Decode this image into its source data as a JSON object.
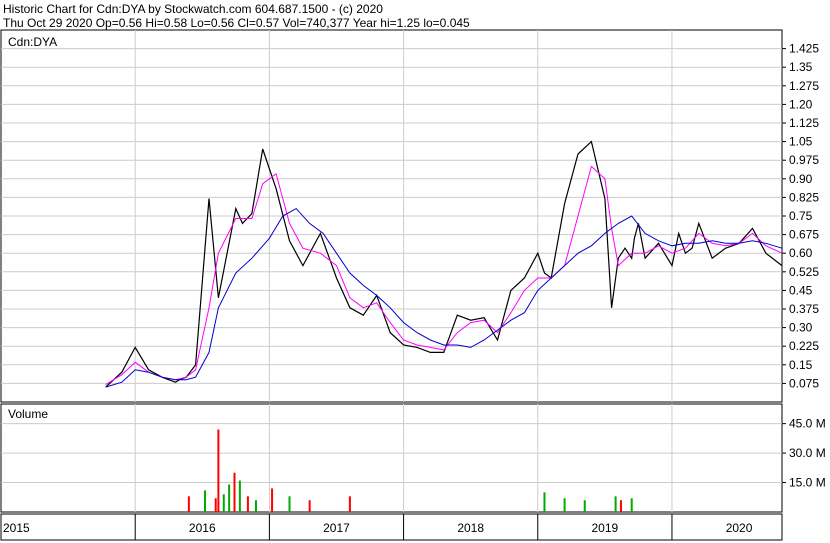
{
  "header": {
    "line1": "Historic Chart for Cdn:DYA by Stockwatch.com 604.687.1500 - (c) 2020",
    "line2": "Thu Oct 29 2020  Op=0.56  Hi=0.58  Lo=0.56  Cl=0.57  Vol=740,377  Year hi=1.25  lo=0.045"
  },
  "chart_data": [
    {
      "type": "line",
      "title": "Cdn:DYA",
      "x_labels": [
        "2015",
        "2016",
        "2017",
        "2018",
        "2019",
        "2020"
      ],
      "ylim": [
        0.0,
        1.5
      ],
      "y_ticks": [
        "1.425",
        "1.35",
        "1.275",
        "1.20",
        "1.125",
        "1.05",
        "0.975",
        "0.90",
        "0.825",
        "0.75",
        "0.675",
        "0.60",
        "0.525",
        "0.45",
        "0.375",
        "0.30",
        "0.225",
        "0.15",
        "0.075"
      ],
      "grid": true,
      "series": [
        {
          "color": "#000000",
          "x": [
            2015.78,
            2015.9,
            2016.0,
            2016.1,
            2016.2,
            2016.25,
            2016.3,
            2016.33,
            2016.38,
            2016.45,
            2016.55,
            2016.62,
            2016.75,
            2016.8,
            2016.87,
            2016.95,
            2017.05,
            2017.15,
            2017.25,
            2017.38,
            2017.5,
            2017.6,
            2017.7,
            2017.8,
            2017.9,
            2018.0,
            2018.1,
            2018.2,
            2018.3,
            2018.4,
            2018.5,
            2018.6,
            2018.7,
            2018.8,
            2018.9,
            2019.0,
            2019.05,
            2019.1,
            2019.2,
            2019.3,
            2019.4,
            2019.5,
            2019.55,
            2019.6,
            2019.65,
            2019.7,
            2019.72,
            2019.75,
            2019.8,
            2019.9,
            2020.0,
            2020.05,
            2020.1,
            2020.15,
            2020.2,
            2020.3,
            2020.4,
            2020.5,
            2020.6,
            2020.7,
            2020.82
          ],
          "y": [
            0.06,
            0.12,
            0.22,
            0.13,
            0.1,
            0.09,
            0.08,
            0.09,
            0.1,
            0.15,
            0.82,
            0.42,
            0.78,
            0.72,
            0.76,
            1.02,
            0.86,
            0.65,
            0.55,
            0.68,
            0.5,
            0.38,
            0.35,
            0.43,
            0.28,
            0.23,
            0.22,
            0.2,
            0.2,
            0.35,
            0.33,
            0.34,
            0.25,
            0.45,
            0.5,
            0.6,
            0.52,
            0.5,
            0.8,
            1.0,
            1.05,
            0.82,
            0.38,
            0.58,
            0.62,
            0.58,
            0.66,
            0.72,
            0.58,
            0.64,
            0.55,
            0.68,
            0.6,
            0.62,
            0.72,
            0.58,
            0.62,
            0.64,
            0.7,
            0.6,
            0.55
          ]
        },
        {
          "color": "#ff00ff",
          "x": [
            2015.78,
            2015.9,
            2016.0,
            2016.1,
            2016.2,
            2016.3,
            2016.38,
            2016.45,
            2016.55,
            2016.62,
            2016.75,
            2016.87,
            2016.95,
            2017.05,
            2017.15,
            2017.25,
            2017.38,
            2017.5,
            2017.6,
            2017.7,
            2017.8,
            2017.9,
            2018.0,
            2018.1,
            2018.2,
            2018.3,
            2018.4,
            2018.5,
            2018.6,
            2018.7,
            2018.8,
            2018.9,
            2019.0,
            2019.1,
            2019.2,
            2019.3,
            2019.4,
            2019.5,
            2019.55,
            2019.6,
            2019.7,
            2019.8,
            2019.9,
            2020.0,
            2020.1,
            2020.2,
            2020.3,
            2020.4,
            2020.5,
            2020.6,
            2020.7,
            2020.82
          ],
          "y": [
            0.07,
            0.11,
            0.16,
            0.12,
            0.1,
            0.09,
            0.1,
            0.13,
            0.38,
            0.6,
            0.74,
            0.74,
            0.88,
            0.92,
            0.72,
            0.62,
            0.6,
            0.55,
            0.42,
            0.38,
            0.4,
            0.32,
            0.25,
            0.23,
            0.22,
            0.21,
            0.28,
            0.32,
            0.33,
            0.28,
            0.36,
            0.45,
            0.5,
            0.5,
            0.55,
            0.75,
            0.95,
            0.9,
            0.7,
            0.55,
            0.6,
            0.6,
            0.63,
            0.6,
            0.62,
            0.68,
            0.64,
            0.63,
            0.64,
            0.68,
            0.63,
            0.6
          ]
        },
        {
          "color": "#0000cc",
          "x": [
            2015.78,
            2015.9,
            2016.0,
            2016.1,
            2016.2,
            2016.3,
            2016.38,
            2016.45,
            2016.55,
            2016.62,
            2016.75,
            2016.87,
            2017.0,
            2017.1,
            2017.2,
            2017.3,
            2017.4,
            2017.5,
            2017.6,
            2017.7,
            2017.8,
            2017.9,
            2018.0,
            2018.1,
            2018.2,
            2018.3,
            2018.4,
            2018.5,
            2018.6,
            2018.7,
            2018.8,
            2018.9,
            2019.0,
            2019.1,
            2019.2,
            2019.3,
            2019.4,
            2019.5,
            2019.6,
            2019.7,
            2019.8,
            2019.9,
            2020.0,
            2020.1,
            2020.2,
            2020.3,
            2020.4,
            2020.5,
            2020.6,
            2020.7,
            2020.82
          ],
          "y": [
            0.06,
            0.08,
            0.13,
            0.12,
            0.1,
            0.09,
            0.09,
            0.1,
            0.2,
            0.38,
            0.52,
            0.58,
            0.66,
            0.75,
            0.78,
            0.72,
            0.68,
            0.6,
            0.52,
            0.47,
            0.43,
            0.38,
            0.32,
            0.28,
            0.25,
            0.23,
            0.23,
            0.22,
            0.25,
            0.29,
            0.33,
            0.36,
            0.45,
            0.5,
            0.55,
            0.6,
            0.63,
            0.68,
            0.72,
            0.75,
            0.68,
            0.65,
            0.63,
            0.64,
            0.64,
            0.65,
            0.64,
            0.64,
            0.65,
            0.64,
            0.62
          ]
        }
      ]
    },
    {
      "type": "bar",
      "title": "Volume",
      "ylim": [
        0,
        55
      ],
      "y_ticks": [
        "45.0 M",
        "30.0 M",
        "15.0 M"
      ],
      "grid": true,
      "bars": [
        {
          "x": 2016.4,
          "value": 8.0,
          "color": "#ff0000"
        },
        {
          "x": 2016.52,
          "value": 11.0,
          "color": "#00aa00"
        },
        {
          "x": 2016.6,
          "value": 7.0,
          "color": "#ff0000"
        },
        {
          "x": 2016.62,
          "value": 42.0,
          "color": "#ff0000"
        },
        {
          "x": 2016.66,
          "value": 9.0,
          "color": "#00aa00"
        },
        {
          "x": 2016.7,
          "value": 14.0,
          "color": "#00aa00"
        },
        {
          "x": 2016.74,
          "value": 20.0,
          "color": "#ff0000"
        },
        {
          "x": 2016.78,
          "value": 16.0,
          "color": "#00aa00"
        },
        {
          "x": 2016.84,
          "value": 8.0,
          "color": "#ff0000"
        },
        {
          "x": 2016.9,
          "value": 6.0,
          "color": "#00aa00"
        },
        {
          "x": 2017.02,
          "value": 12.0,
          "color": "#ff0000"
        },
        {
          "x": 2017.15,
          "value": 8.0,
          "color": "#00aa00"
        },
        {
          "x": 2017.3,
          "value": 6.0,
          "color": "#ff0000"
        },
        {
          "x": 2017.6,
          "value": 8.0,
          "color": "#ff0000"
        },
        {
          "x": 2019.05,
          "value": 10.0,
          "color": "#00aa00"
        },
        {
          "x": 2019.2,
          "value": 7.0,
          "color": "#00aa00"
        },
        {
          "x": 2019.35,
          "value": 6.0,
          "color": "#00aa00"
        },
        {
          "x": 2019.58,
          "value": 8.0,
          "color": "#00aa00"
        },
        {
          "x": 2019.62,
          "value": 6.0,
          "color": "#ff0000"
        },
        {
          "x": 2019.7,
          "value": 7.0,
          "color": "#00aa00"
        }
      ]
    }
  ]
}
